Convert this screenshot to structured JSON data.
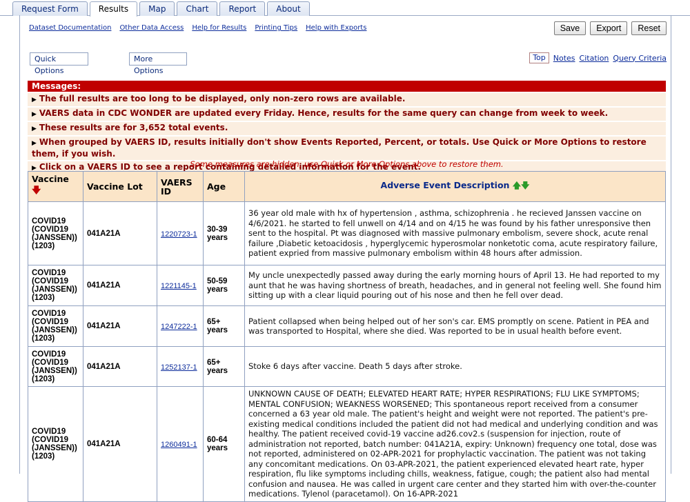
{
  "tabs": [
    "Request Form",
    "Results",
    "Map",
    "Chart",
    "Report",
    "About"
  ],
  "active_tab": "Results",
  "links": [
    "Dataset Documentation",
    "Other Data Access",
    "Help for Results",
    "Printing Tips",
    "Help with Exports"
  ],
  "buttons": {
    "save": "Save",
    "export": "Export",
    "reset": "Reset"
  },
  "options": {
    "quick": "Quick Options",
    "more": "More Options"
  },
  "toplinks": {
    "top": "Top",
    "notes": "Notes",
    "citation": "Citation",
    "query": "Query Criteria"
  },
  "messages": {
    "title": "Messages:",
    "items": [
      "The full results are too long to be displayed, only non-zero rows are available.",
      "VAERS data in CDC WONDER are updated every Friday. Hence, results for the same query can change from week to week.",
      "These results are for 3,652 total events.",
      "When grouped by VAERS ID, results initially don't show Events Reported, Percent, or totals. Use Quick or More Options to restore them, if you wish.",
      "Click on a VAERS ID to see a report containing detailed information for the event."
    ]
  },
  "hidden_note": "Some measures are hidden, use Quick or More Options above to restore them.",
  "table": {
    "headers": {
      "vaccine": "Vaccine",
      "lot": "Vaccine Lot",
      "id": "VAERS ID",
      "age": "Age",
      "desc": "Adverse Event Description"
    },
    "rows": [
      {
        "vaccine": "COVID19 (COVID19 (JANSSEN)) (1203)",
        "lot": "041A21A",
        "id": "1220723-1",
        "age": "30-39 years",
        "desc": "36 year old male with hx of hypertension , asthma, schizophrenia . he recieved Janssen vaccine on 4/6/2021. he started to fell unwell on 4/14 and on 4/15 he was found by his father unresponsive then sent to the hospital. Pt was diagnosed with massive pulmonary embolism, severe shock, acute renal failure ,Diabetic ketoacidosis , hyperglycemic hyperosmolar nonketotic coma, acute respiratory failure, patient expried from massive pulmonary embolism within 48 hours after admission."
      },
      {
        "vaccine": "COVID19 (COVID19 (JANSSEN)) (1203)",
        "lot": "041A21A",
        "id": "1221145-1",
        "age": "50-59 years",
        "desc": "My uncle unexpectedly passed away during the early morning hours of April 13. He had reported to my aunt that he was having shortness of breath, headaches, and in general not feeling well. She found him sitting up with a clear liquid pouring out of his nose and then he fell over dead."
      },
      {
        "vaccine": "COVID19 (COVID19 (JANSSEN)) (1203)",
        "lot": "041A21A",
        "id": "1247222-1",
        "age": "65+ years",
        "desc": "Patient collapsed when being helped out of her son's car. EMS promptly on scene. Patient in PEA and was transported to Hospital, where she died. Was reported to be in usual health before event."
      },
      {
        "vaccine": "COVID19 (COVID19 (JANSSEN)) (1203)",
        "lot": "041A21A",
        "id": "1252137-1",
        "age": "65+ years",
        "desc": "Stoke 6 days after vaccine. Death 5 days after stroke."
      },
      {
        "vaccine": "COVID19 (COVID19 (JANSSEN)) (1203)",
        "lot": "041A21A",
        "id": "1260491-1",
        "age": "60-64 years",
        "desc": "UNKNOWN CAUSE OF DEATH; ELEVATED HEART RATE; HYPER RESPIRATIONS; FLU LIKE SYMPTOMS; MENTAL CONFUSION; WEAKNESS WORSENED; This spontaneous report received from a consumer concerned a 63 year old male. The patient's height and weight were not reported. The patient's pre-existing medical conditions included the patient did not had medical and underlying condition and was healthy. The patient received covid-19 vaccine ad26.cov2.s (suspension for injection, route of administration not reported, batch number: 041A21A, expiry: Unknown) frequency one total, dose was not reported, administered on 02-APR-2021 for prophylactic vaccination. The patient was not taking any concomitant medications. On 03-APR-2021, the patient experienced elevated heart rate, hyper respiration, flu like symptoms including chills, weakness, fatigue, cough; the patient also had mental confusion and nausea. He was called in urgent care center and they started him with over-the-counter medications. Tylenol (paracetamol). On 16-APR-2021"
      }
    ]
  }
}
